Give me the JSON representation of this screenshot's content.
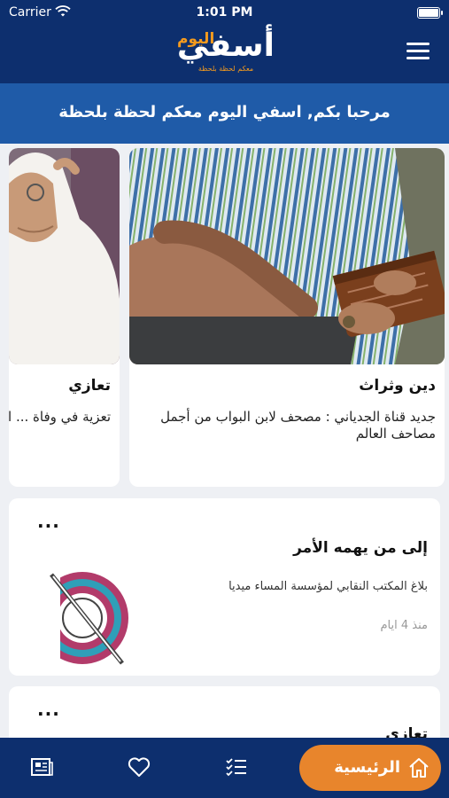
{
  "status_bar": {
    "carrier": "Carrier",
    "time": "1:01 PM"
  },
  "header": {
    "logo_main": "أسفي",
    "logo_accent": "اليوم",
    "logo_tagline": "معكم لحظة بلحظة",
    "welcome": "مرحبا بكم, اسفي اليوم معكم لحظة بلحظة"
  },
  "featured": [
    {
      "category": "دين وثراث",
      "title": "جديد قناة الجدياني : مصحف لابن البواب من أجمل مصاحف العالم"
    },
    {
      "category": "تعازي",
      "title": "تعزية في وفاة ... الحضاري"
    }
  ],
  "list": [
    {
      "title": "إلى من يهمه الأمر",
      "description": "بلاغ المكتب النقابي لمؤسسة المساء ميديا",
      "time": "منذ 4 ايام",
      "more": "..."
    },
    {
      "title": "تعازي",
      "more": "..."
    }
  ],
  "tabbar": {
    "home_label": "الرئيسية"
  },
  "colors": {
    "navy": "#0d2f6e",
    "blue": "#1f5ba8",
    "orange": "#e8852c"
  }
}
